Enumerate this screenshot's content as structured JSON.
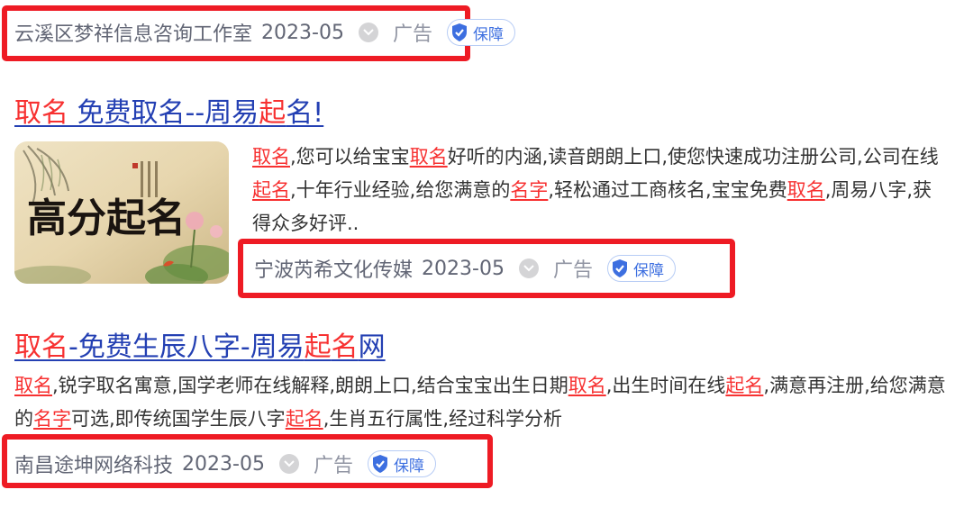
{
  "results": [
    {
      "meta": {
        "source": "云溪区梦祥信息咨询工作室",
        "date": "2023-05",
        "ad_label": "广告",
        "guarantee": "保障"
      }
    },
    {
      "title_parts": [
        "取名",
        " 免费取名--周易",
        "起",
        "名!"
      ],
      "description_parts": [
        "取名",
        ",您可以给宝宝",
        "取名",
        "好听的内涵,读音朗朗上口,使您快速成功注册公司,公司在线",
        "起名",
        ",十年行业经验,给您满意的",
        "名字",
        ",轻松通过工商核名,宝宝免费",
        "取名",
        ",周易八字,获得众多好评.."
      ],
      "thumbnail": {
        "calligraphy": "高分起名"
      },
      "meta": {
        "source": "宁波芮希文化传媒",
        "date": "2023-05",
        "ad_label": "广告",
        "guarantee": "保障"
      }
    },
    {
      "title_parts": [
        "取名",
        "-免费生辰八字-周易",
        "起",
        "名",
        "网"
      ],
      "description_parts": [
        "取名",
        ",锐字取名寓意,国学老师在线解释,朗朗上口,结合宝宝出生日期",
        "取名",
        ",出生时间在线",
        "起名",
        ",满意再注册,给您满意的",
        "名字",
        "可选,即传统国学生辰八字",
        "起名",
        ",生肖五行属性,经过科学分析"
      ],
      "meta": {
        "source": "南昌途坤网络科技",
        "date": "2023-05",
        "ad_label": "广告",
        "guarantee": "保障"
      }
    }
  ],
  "colors": {
    "title": "#2440b3",
    "highlight": "#f73131",
    "annotation_box": "#ee1b24",
    "guarantee_blue": "#3d6fe0"
  }
}
